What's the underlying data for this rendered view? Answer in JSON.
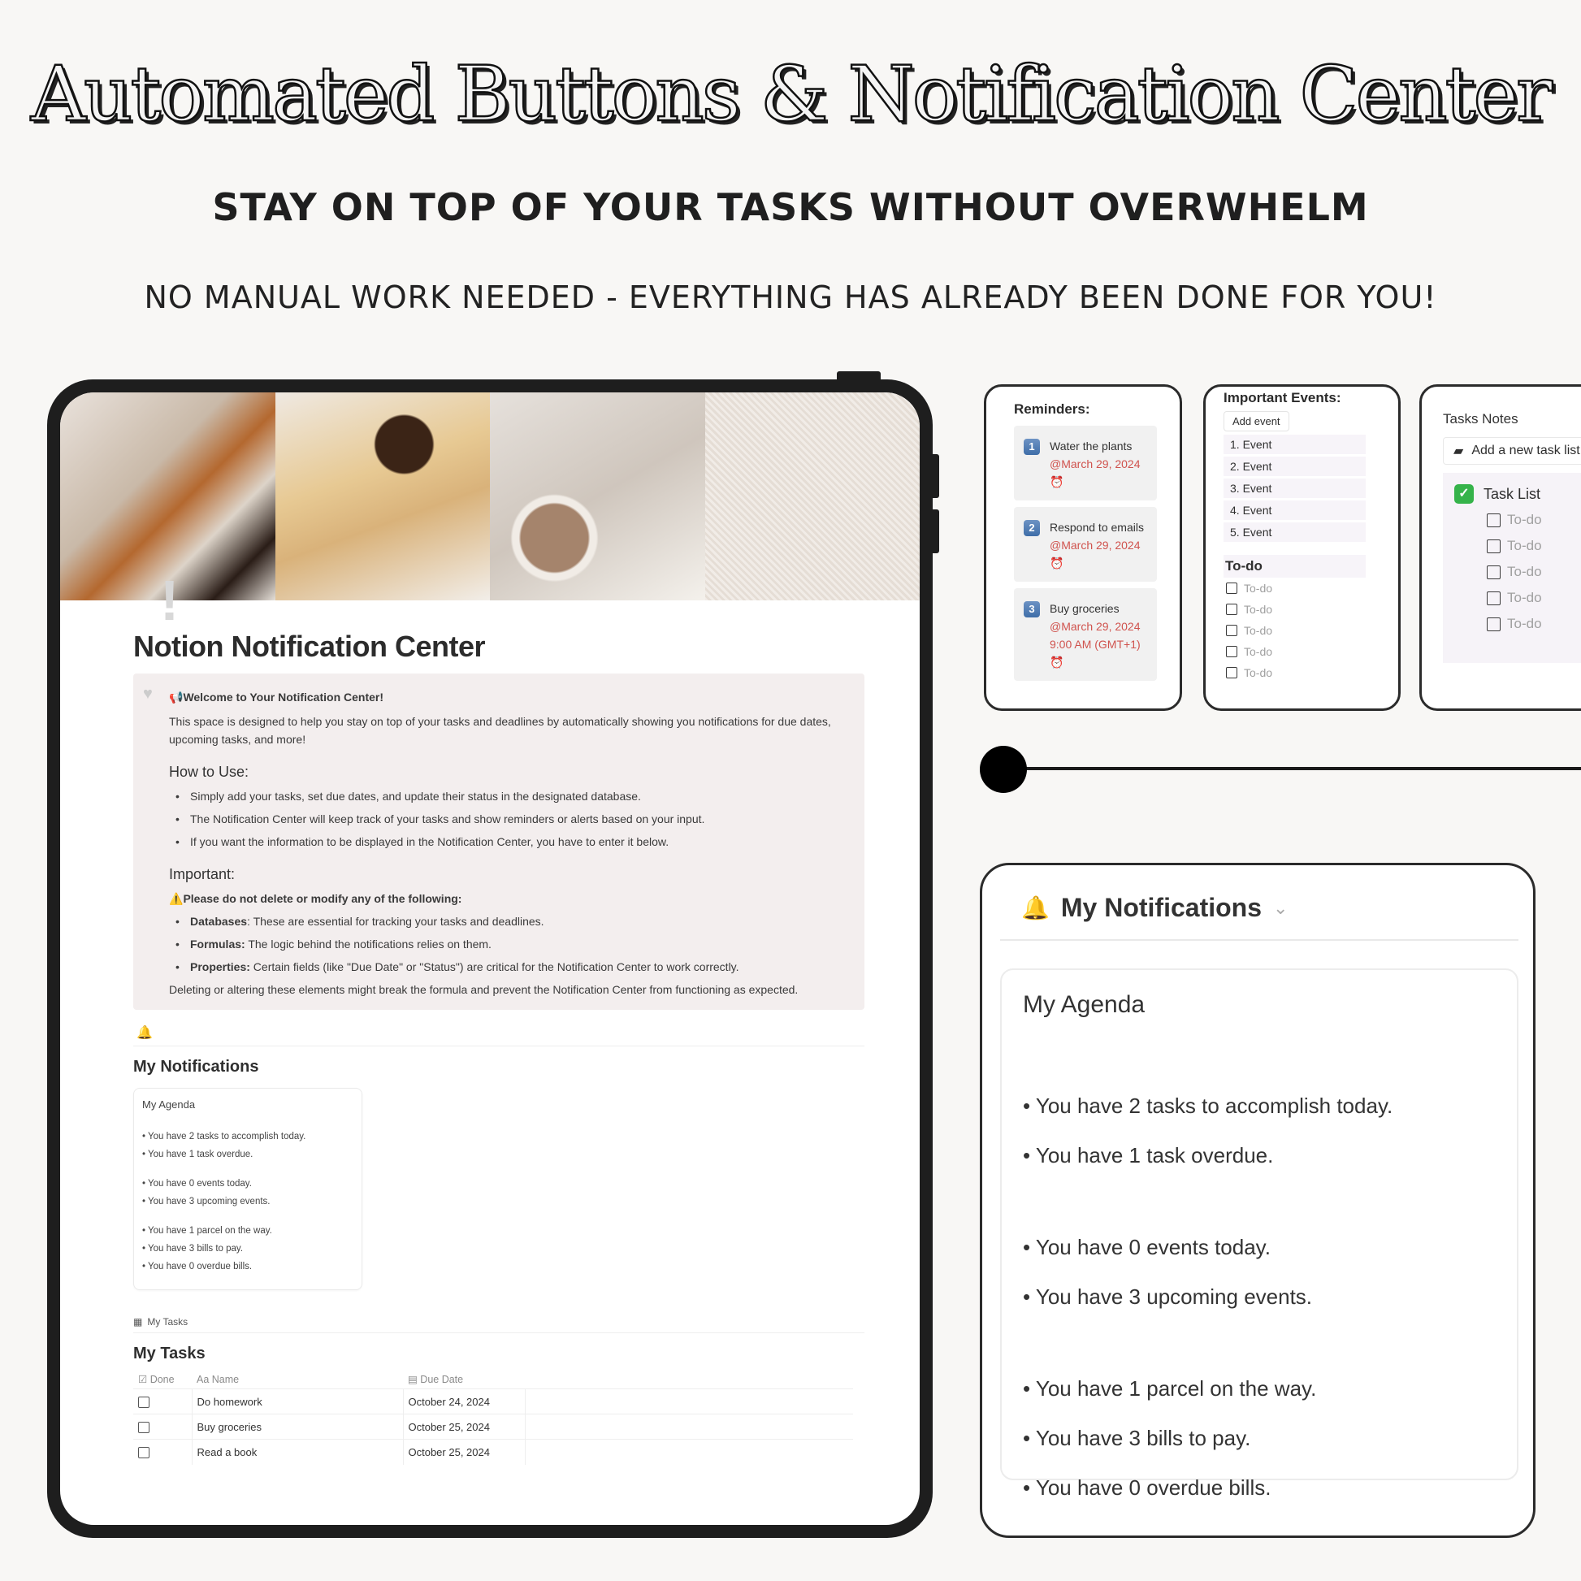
{
  "hero": {
    "title": "Automated Buttons & Notification Center",
    "subtitle": "STAY ON TOP OF YOUR TASKS WITHOUT OVERWHELM",
    "tagline": "NO MANUAL WORK NEEDED - EVERYTHING HAS ALREADY BEEN DONE FOR YOU!"
  },
  "tablet": {
    "page_icon": "exclamation-icon",
    "page_title": "Notion Notification Center",
    "callout": {
      "welcome": "Welcome to Your Notification Center!",
      "intro": "This space is designed to help you stay on top of your tasks and deadlines by automatically showing you notifications for due dates, upcoming tasks, and more!",
      "how_heading": "How to Use:",
      "how_items": [
        "Simply add your tasks, set due dates, and update their status in the designated database.",
        "The Notification Center will keep track of your tasks and show reminders or alerts based on your input.",
        "If you want the information to be displayed in the Notification Center, you have to enter it below."
      ],
      "important_heading": "Important:",
      "warning": "Please do not delete or modify any of the following:",
      "important_items": [
        {
          "term": "Databases",
          "text": ": These are essential for tracking your tasks and deadlines."
        },
        {
          "term": "Formulas:",
          "text": " The logic behind the notifications relies on them."
        },
        {
          "term": "Properties:",
          "text": " Certain fields (like \"Due Date\" or \"Status\") are critical for the Notification Center to work correctly."
        }
      ],
      "footer": "Deleting or altering these elements might break the formula and prevent the Notification Center from functioning as expected."
    },
    "notifications_title": "My Notifications",
    "agenda": {
      "title": "My Agenda",
      "groups": [
        [
          "You have 2 tasks to accomplish today.",
          "You have 1 task overdue."
        ],
        [
          "You have 0 events today.",
          "You have 3 upcoming events."
        ],
        [
          "You have 1 parcel on the way.",
          "You have 3 bills to pay.",
          "You have 0 overdue bills."
        ]
      ]
    },
    "db_link": "My Tasks",
    "tasks_title": "My Tasks",
    "table": {
      "columns": [
        "Done",
        "Name",
        "Due Date"
      ],
      "rows": [
        {
          "done": false,
          "name": "Do homework",
          "due": "October 24, 2024"
        },
        {
          "done": false,
          "name": "Buy groceries",
          "due": "October 25, 2024"
        },
        {
          "done": false,
          "name": "Read a book",
          "due": "October 25, 2024"
        }
      ]
    }
  },
  "reminders": {
    "title": "Reminders:",
    "items": [
      {
        "num": "1",
        "text": "Water the plants ",
        "date": "@March 29, 2024"
      },
      {
        "num": "2",
        "text": "Respond to emails ",
        "date": "@March 29, 2024"
      },
      {
        "num": "3",
        "text": "Buy groceries ",
        "date": "@March 29, 2024 9:00 AM (GMT+1)"
      }
    ]
  },
  "events": {
    "title": "Important Events:",
    "add_button": "Add event",
    "items": [
      "1.  Event",
      "2.  Event",
      "3.  Event",
      "4.  Event",
      "5.  Event"
    ],
    "todo_heading": "To-do",
    "todos": [
      "To-do",
      "To-do",
      "To-do",
      "To-do",
      "To-do"
    ]
  },
  "task_notes": {
    "title": "Tasks Notes",
    "add_button": "Add a new task list",
    "list_title": "Task List",
    "todos": [
      "To-do",
      "To-do",
      "To-do",
      "To-do",
      "To-do"
    ]
  },
  "slider": {
    "value": 0
  },
  "notif_panel": {
    "title": "My Notifications",
    "agenda_title": "My Agenda"
  },
  "colors": {
    "accent_red": "#d0534e",
    "callout_bg": "#f3eeee",
    "frame": "#1e1e1e"
  }
}
